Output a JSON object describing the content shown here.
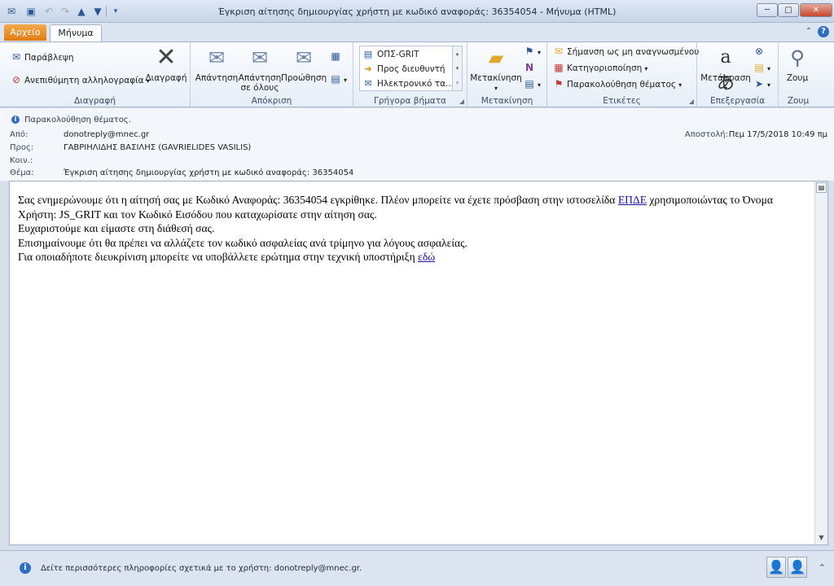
{
  "window": {
    "title": "Έγκριση αίτησης δημιουργίας χρήστη με κωδικό αναφοράς: 36354054  -  Μήνυμα (HTML)"
  },
  "tabs": {
    "file": "Αρχείο",
    "message": "Μήνυμα"
  },
  "ribbon": {
    "delete_group": {
      "label": "Διαγραφή",
      "ignore": "Παράβλεψη",
      "junk": "Ανεπιθύμητη αλληλογραφία",
      "delete": "Διαγραφή"
    },
    "respond_group": {
      "label": "Απόκριση",
      "reply": "Απάντηση",
      "reply_all_line1": "Απάντηση",
      "reply_all_line2": "σε όλους",
      "forward": "Προώθηση"
    },
    "quicksteps_group": {
      "label": "Γρήγορα βήματα",
      "items": [
        "ΟΠΣ-GRIT",
        "Προς διευθυντή",
        "Ηλεκτρονικό τα..."
      ]
    },
    "move_group": {
      "label": "Μετακίνηση",
      "move": "Μετακίνηση"
    },
    "tags_group": {
      "label": "Ετικέτες",
      "mark_unread": "Σήμανση ως μη αναγνωσμένου",
      "categorize": "Κατηγοριοποίηση",
      "follow_up": "Παρακολούθηση θέματος"
    },
    "editing_group": {
      "label": "Επεξεργασία",
      "translate": "Μετάφραση"
    },
    "zoom_group": {
      "label": "Ζουμ",
      "zoom": "Ζουμ"
    }
  },
  "header": {
    "info": "Παρακολούθηση θέματος.",
    "from_label": "Από:",
    "from": "donotreply@mnec.gr",
    "to_label": "Προς:",
    "to": "ΓΑΒΡΙΗΛΙΔΗΣ ΒΑΣΙΛΗΣ (GAVRIELIDES VASILIS)",
    "cc_label": "Κοιν.:",
    "cc": "",
    "subject_label": "Θέμα:",
    "subject": "Έγκριση αίτησης δημιουργίας χρήστη με κωδικό αναφοράς: 36354054",
    "sent_label": "Αποστολή:",
    "sent": "Πεμ 17/5/2018 10:49 πμ"
  },
  "body": {
    "p1_start": "Σας ενημερώνουμε ότι η αίτησή σας με Κωδικό Αναφοράς: 36354054 εγκρίθηκε. Πλέον μπορείτε να έχετε πρόσβαση στην ιστοσελίδα ",
    "p1_link": "ΕΠΔΕ",
    "p1_end": " χρησιμοποιώντας το Όνομα Χρήστη: JS_GRIT και τον Κωδικό Εισόδου που καταχωρίσατε στην αίτηση σας.",
    "p2": "Ευχαριστούμε και είμαστε στη διάθεσή σας.",
    "p3": "Επισημαίνουμε ότι θα πρέπει να αλλάζετε τον κωδικό ασφαλείας ανά τρίμηνο για λόγους ασφαλείας.",
    "p4_start": "Για οποιαδήποτε διευκρίνιση μπορείτε να υποβάλλετε ερώτημα στην τεχνική υποστήριξη ",
    "p4_link": "εδώ"
  },
  "people_pane": {
    "info": "Δείτε περισσότερες πληροφορίες σχετικά με το χρήστη: donotreply@mnec.gr."
  },
  "icons": {
    "accent": "#2b5797",
    "file_tab": "#e07b14"
  }
}
